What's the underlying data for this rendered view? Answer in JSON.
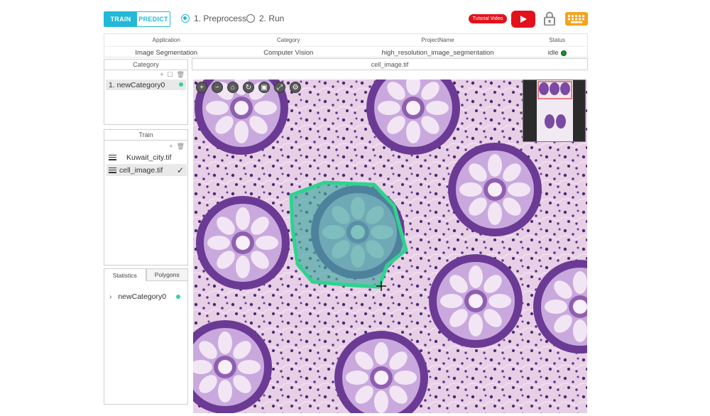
{
  "mode": {
    "train_label": "TRAIN",
    "predict_label": "PREDICT",
    "active": "TRAIN"
  },
  "steps": [
    {
      "label": "1. Preprocess",
      "selected": true
    },
    {
      "label": "2. Run",
      "selected": false
    }
  ],
  "toolbar": {
    "tutorial_label": "Tutorial Video",
    "icons": [
      "youtube-icon",
      "lock-icon",
      "keyboard-icon"
    ]
  },
  "project": {
    "headers": [
      "Application",
      "Category",
      "ProjectName",
      "Status"
    ],
    "row": [
      "Image Segmentation",
      "Computer Vision",
      "high_resolution_image_segmentation",
      "idle"
    ]
  },
  "category_panel": {
    "title": "Category",
    "tools": [
      "+",
      "☐",
      "🗑"
    ],
    "items": [
      {
        "label": "1. newCategory0"
      }
    ]
  },
  "train_panel": {
    "title": "Train",
    "tools": [
      "+",
      "🗑"
    ],
    "items": [
      {
        "label": "Kuwait_city.tif",
        "selected": false
      },
      {
        "label": "cell_image.tif",
        "selected": true,
        "check": "✓"
      }
    ]
  },
  "bottom_panel": {
    "tabs": [
      "Statistics",
      "Polygons"
    ],
    "active_tab": "Statistics",
    "items": [
      {
        "arrow": "›",
        "label": "newCategory0"
      }
    ]
  },
  "image_panel": {
    "title": "cell_image.tif"
  },
  "zoom_tools": [
    {
      "name": "zoom-in-icon",
      "glyph": "+"
    },
    {
      "name": "zoom-out-icon",
      "glyph": "−"
    },
    {
      "name": "home-icon",
      "glyph": "⌂"
    },
    {
      "name": "rotate-icon",
      "glyph": "↻"
    },
    {
      "name": "fit-icon",
      "glyph": "▣"
    },
    {
      "name": "fullscreen-icon",
      "glyph": "⤢"
    },
    {
      "name": "settings-icon",
      "glyph": "⚙"
    }
  ],
  "colors": {
    "accent": "#22b8d6",
    "youtube_red": "#e3111b",
    "keyboard_orange": "#f6a21b",
    "category_green": "#2fd3a5",
    "status_green": "#1c8e2a"
  }
}
